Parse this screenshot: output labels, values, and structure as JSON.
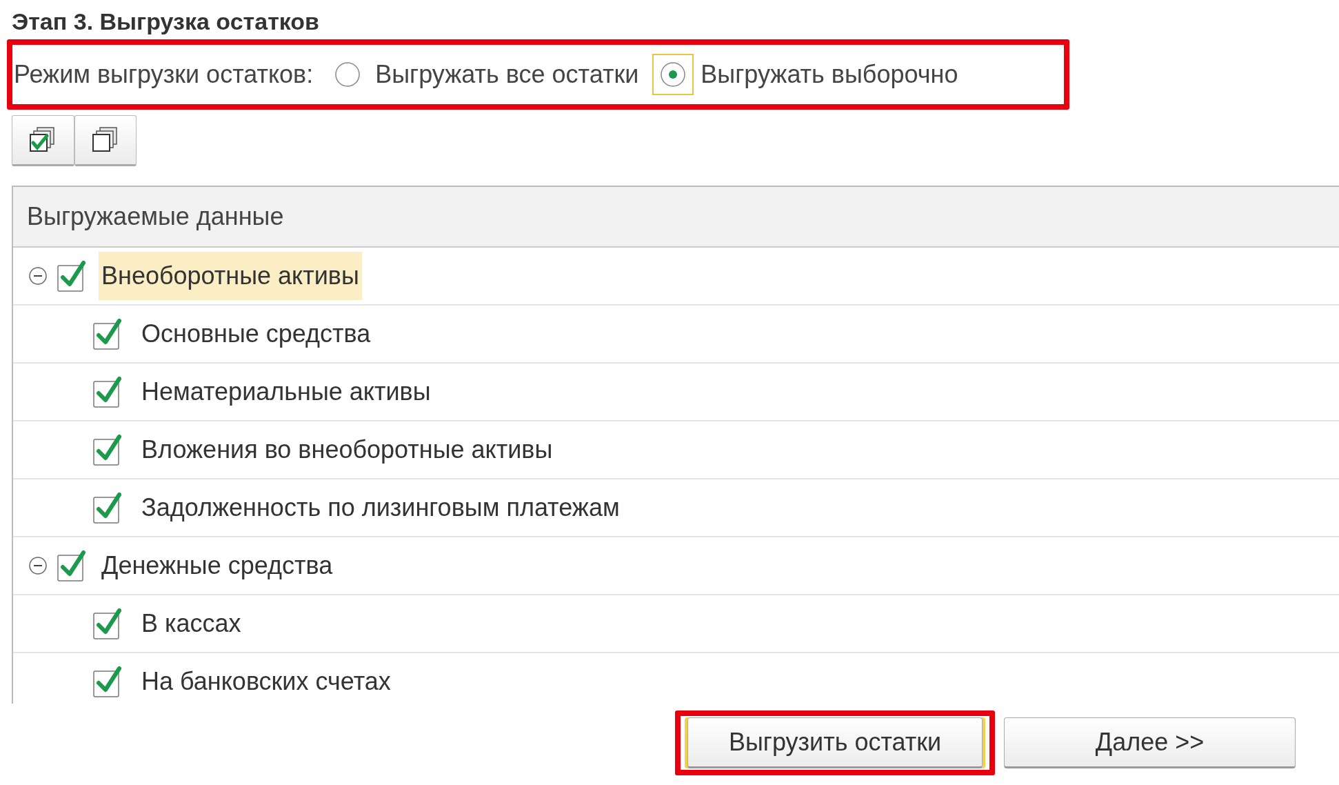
{
  "title": "Этап 3. Выгрузка остатков",
  "mode": {
    "label": "Режим выгрузки остатков:",
    "highlighted": true,
    "options": [
      {
        "label": "Выгружать все остатки",
        "selected": false
      },
      {
        "label": "Выгружать выборочно",
        "selected": true
      }
    ]
  },
  "table": {
    "column": "Выгружаемые данные",
    "rows": [
      {
        "label": "Внеоборотные активы",
        "checked": true,
        "expanded": true,
        "current": true,
        "children": [
          {
            "label": "Основные средства",
            "checked": true
          },
          {
            "label": "Нематериальные активы",
            "checked": true
          },
          {
            "label": "Вложения во внеоборотные активы",
            "checked": true
          },
          {
            "label": "Задолженность по лизинговым платежам",
            "checked": true
          }
        ]
      },
      {
        "label": "Денежные средства",
        "checked": true,
        "expanded": true,
        "current": false,
        "children": [
          {
            "label": "В кассах",
            "checked": true
          },
          {
            "label": "На банковских счетах",
            "checked": true
          }
        ]
      }
    ]
  },
  "buttons": [
    {
      "label": "Выгрузить остатки",
      "highlighted": true
    },
    {
      "label": "Далее >>",
      "highlighted": false
    }
  ]
}
